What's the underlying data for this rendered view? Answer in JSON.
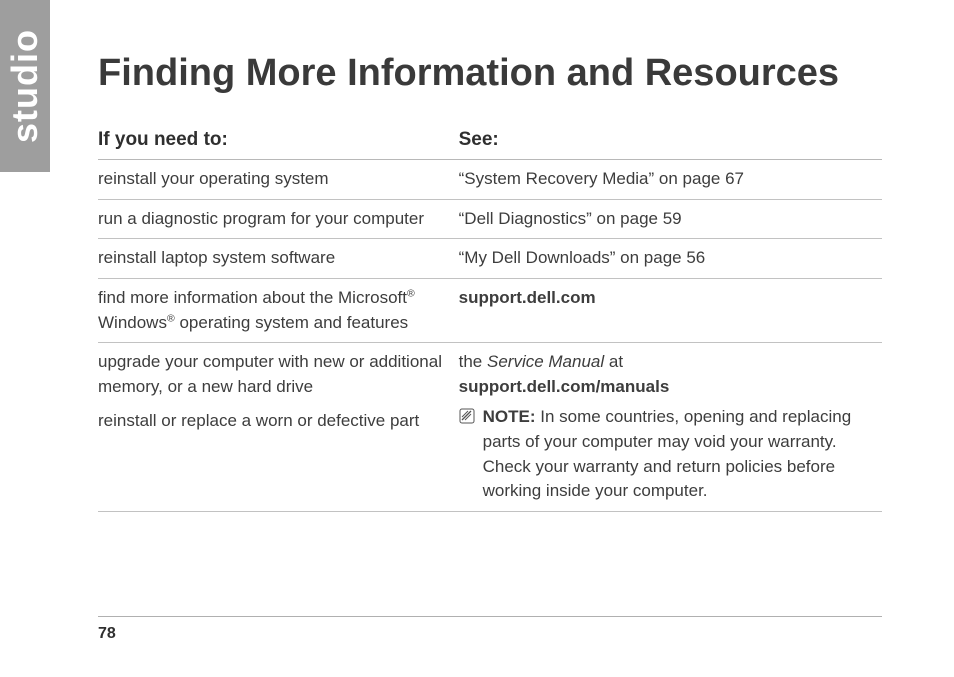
{
  "side_tab": "studio",
  "title": "Finding More Information and Resources",
  "page_number": "78",
  "headers": {
    "left": "If you need to:",
    "right": "See:"
  },
  "rows": [
    {
      "need": "reinstall your operating system",
      "see": "“System Recovery Media” on page 67"
    },
    {
      "need": "run a diagnostic program for your computer",
      "see": "“Dell Diagnostics” on page 59"
    },
    {
      "need": "reinstall laptop system software",
      "see": "“My Dell Downloads” on page 56"
    },
    {
      "need_prefix": "find more information about the Microsoft",
      "need_sup1": "®",
      "need_mid": " Windows",
      "need_sup2": "®",
      "need_suffix": " operating system and features",
      "see_bold": "support.dell.com"
    },
    {
      "need_line1": "upgrade your computer with new or additional memory, or a new hard drive",
      "need_line2": "reinstall or replace a worn or defective part",
      "see_pre": "the ",
      "see_ital": "Service Manual",
      "see_post": " at",
      "see_bold": "support.dell.com/manuals",
      "note_label": "NOTE:",
      "note_body": " In some countries, opening and replacing parts of your computer may void your warranty. Check your warranty and return policies before working inside your computer."
    }
  ]
}
